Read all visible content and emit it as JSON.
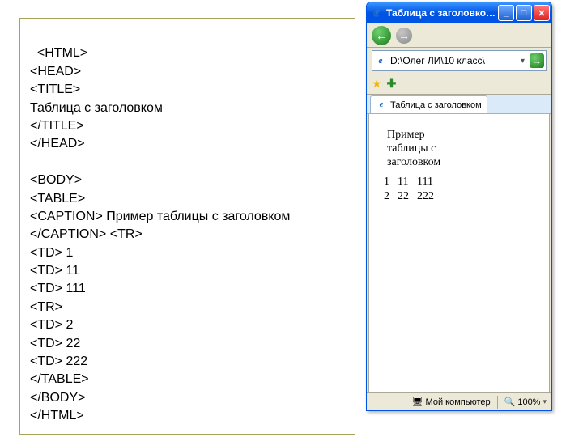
{
  "code_panel": {
    "text": "<HTML>\n<HEAD>\n<TITLE>\nТаблица с заголовком\n</TITLE>\n</HEAD>\n\n<BODY>\n<TABLE>\n<CAPTION> Пример таблицы с заголовком </CAPTION> <TR>\n<TD> 1\n<TD> 11\n<TD> 111\n<TR>\n<TD> 2\n<TD> 22\n<TD> 222\n</TABLE>\n</BODY>\n</HTML>"
  },
  "browser": {
    "title": "Таблица с заголовко…",
    "address": "D:\\Олег ЛИ\\10 класс\\",
    "tab_label": "Таблица с заголовком",
    "status_left": "Мой компьютер",
    "status_zoom": "100%"
  },
  "page": {
    "caption": "Пример таблицы с заголовком",
    "rows": [
      [
        "1",
        "11",
        "111"
      ],
      [
        "2",
        "22",
        "222"
      ]
    ]
  },
  "icons": {
    "ie": "e",
    "back": "←",
    "fwd": "→",
    "go": "→",
    "dd": "▾",
    "star": "★",
    "plus": "✚",
    "min": "_",
    "max": "□",
    "close": "✕",
    "search": "🔍",
    "computer": "🖥"
  }
}
